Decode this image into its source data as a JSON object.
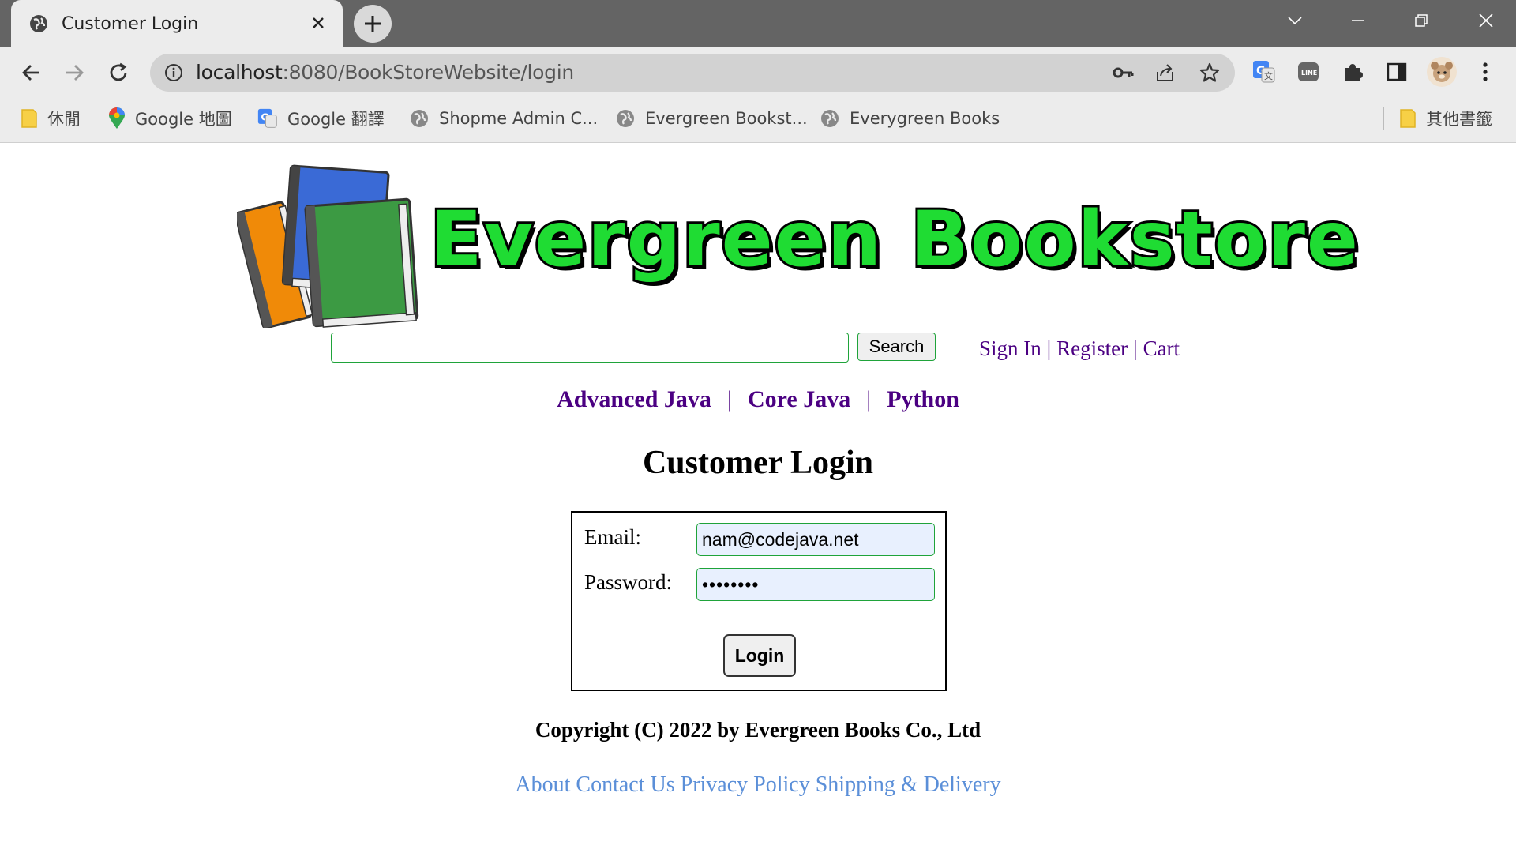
{
  "browser": {
    "tab": {
      "title": "Customer Login"
    },
    "address": {
      "host": "localhost",
      "rest": ":8080/BookStoreWebsite/login"
    },
    "bookmarks": [
      {
        "label": "休閒",
        "icon": "folder-icon"
      },
      {
        "label": "Google 地圖",
        "icon": "maps-icon"
      },
      {
        "label": "Google 翻譯",
        "icon": "translate-icon"
      },
      {
        "label": "Shopme Admin C...",
        "icon": "globe-icon"
      },
      {
        "label": "Evergreen Bookst...",
        "icon": "globe-icon"
      },
      {
        "label": "Everygreen Books",
        "icon": "globe-icon"
      }
    ],
    "other_bookmarks": "其他書籤"
  },
  "site": {
    "logo_text": "Evergreen Bookstore",
    "search": {
      "value": "",
      "button": "Search"
    },
    "account_links": {
      "sign_in": "Sign In",
      "register": "Register",
      "cart": "Cart",
      "separator": "|"
    },
    "categories": [
      "Advanced Java",
      "Core Java",
      "Python"
    ],
    "category_separator": "|"
  },
  "login": {
    "title": "Customer Login",
    "email_label": "Email:",
    "email_value": "nam@codejava.net",
    "password_label": "Password:",
    "password_value": "••••••••",
    "button": "Login"
  },
  "footer": {
    "copyright": "Copyright (C) 2022 by Evergreen Books Co., Ltd",
    "links": [
      "About",
      "Contact Us",
      "Privacy Policy",
      "Shipping & Delivery"
    ]
  },
  "colors": {
    "brand_green": "#1fdc33",
    "link_purple": "#4b0082",
    "footer_link": "#5b8fd8",
    "input_border": "#1fa33a"
  }
}
